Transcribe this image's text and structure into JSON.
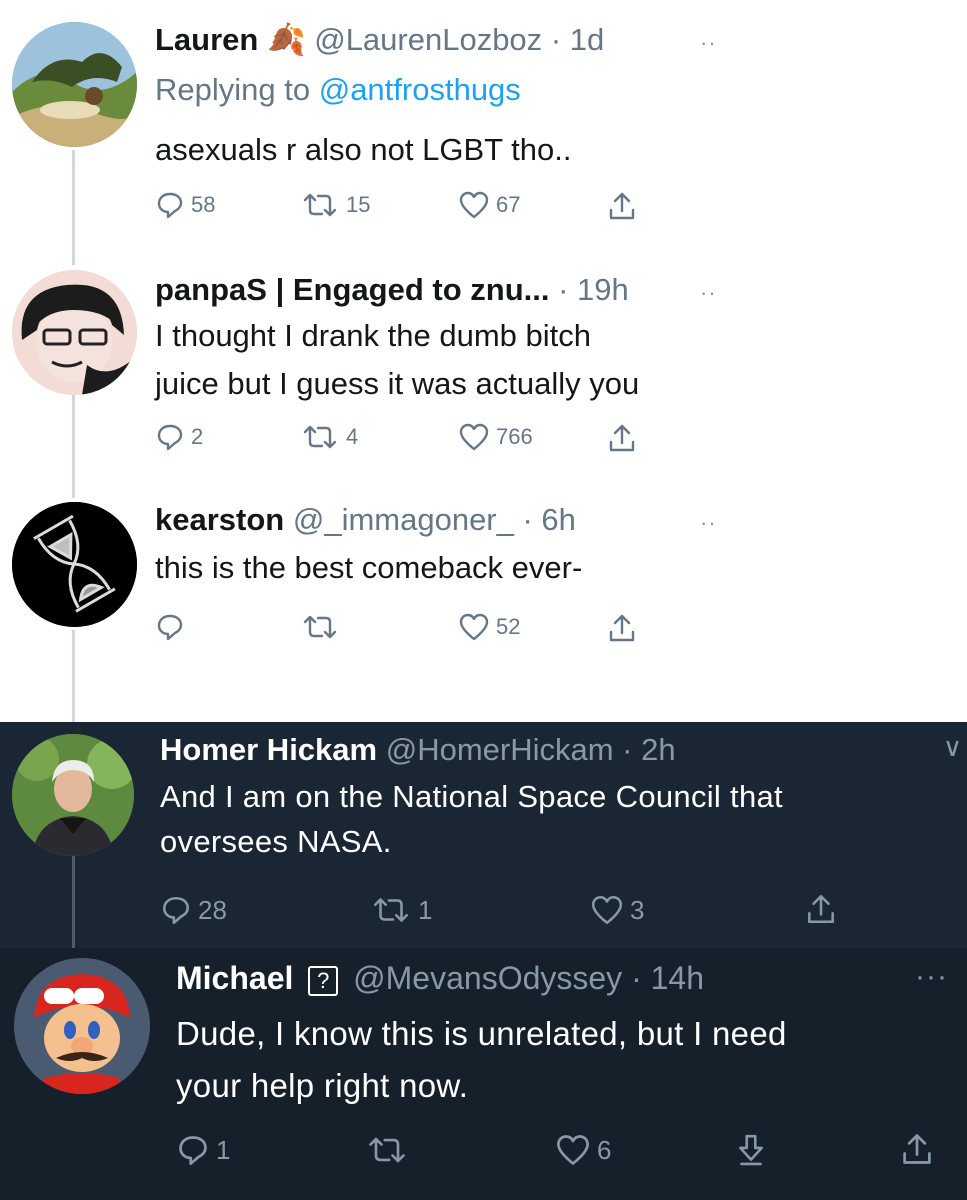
{
  "tweets": [
    {
      "name": "Lauren",
      "name_emoji": "🍂",
      "handle": "@LaurenLozboz",
      "time": "· 1d",
      "replying_prefix": "Replying to",
      "replying_to": "@antfrosthugs",
      "text": "asexuals r also not LGBT tho..",
      "replies": "58",
      "retweets": "15",
      "likes": "67",
      "more": "··"
    },
    {
      "name": "panpaS | Engaged to znu...",
      "handle": "",
      "time": "· 19h",
      "text": "I thought I drank the dumb bitch\njuice but I guess it was actually you",
      "replies": "2",
      "retweets": "4",
      "likes": "766",
      "more": "··"
    },
    {
      "name": "kearston",
      "handle": "@_immagoner_",
      "time": "· 6h",
      "text": "this is the best comeback ever-",
      "replies": "",
      "retweets": "",
      "likes": "52",
      "more": "··"
    },
    {
      "name": "Homer Hickam",
      "handle": "@HomerHickam",
      "time": "· 2h",
      "text": "And I am on the National Space Council that\noversees NASA.",
      "replies": "28",
      "retweets": "1",
      "likes": "3",
      "more": "∨"
    },
    {
      "name": "Michael",
      "name_badge": "?",
      "handle": "@MevansOdyssey",
      "time": "· 14h",
      "text": "Dude, I know this is unrelated, but I need\nyour help right now.",
      "replies": "1",
      "retweets": "",
      "likes": "6",
      "more": "···"
    }
  ],
  "colors": {
    "light_bg": "#ffffff",
    "dark_bg_1": "#1b2634",
    "dark_bg_2": "#15202b",
    "mention": "#1da1f2",
    "muted": "#657786"
  }
}
